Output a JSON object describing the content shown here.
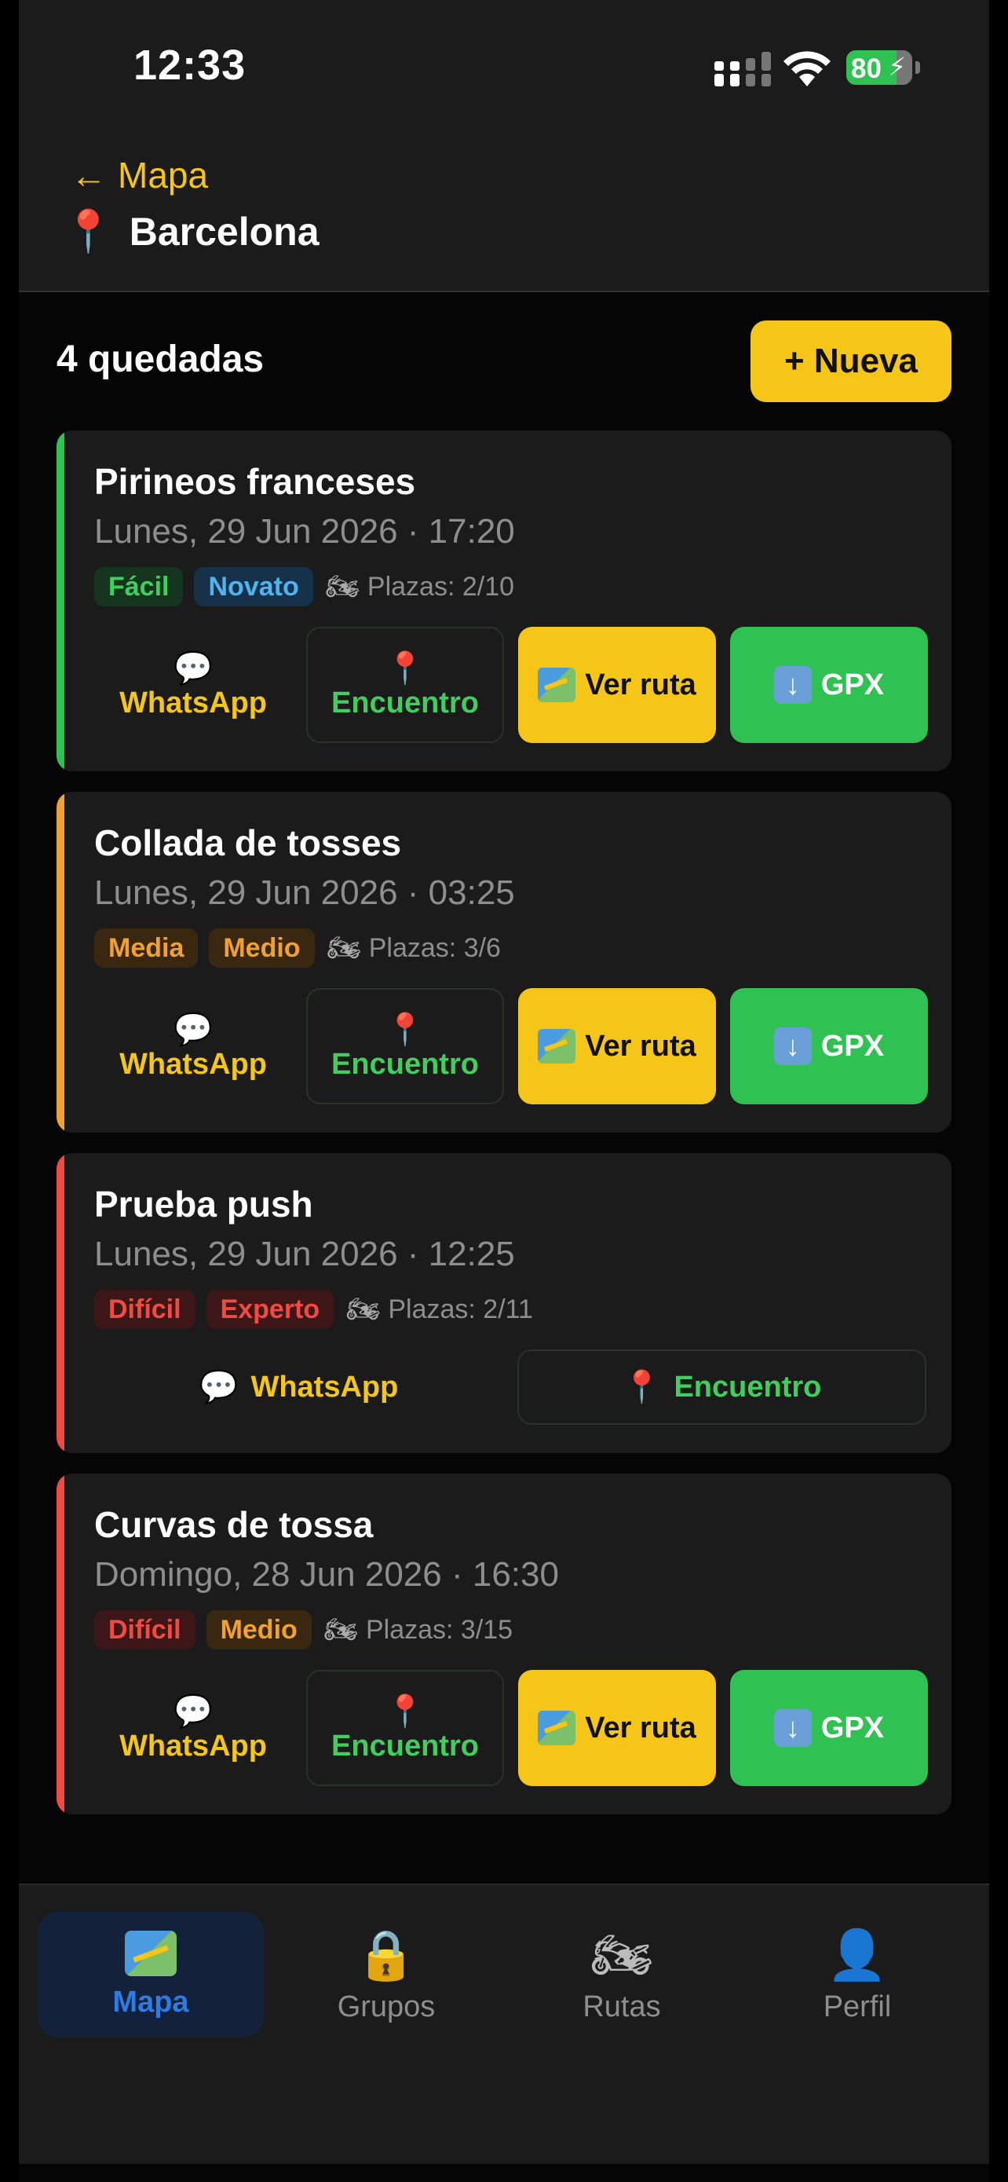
{
  "status_bar": {
    "time": "12:33",
    "battery": "80"
  },
  "header": {
    "back_label": "Mapa",
    "city": "Barcelona"
  },
  "list": {
    "count_label": "4 quedadas",
    "new_button": "+ Nueva"
  },
  "colors": {
    "accent_yellow": "#f5c518",
    "green": "#2fc253",
    "orange": "#f0a132",
    "red": "#ef4b43",
    "blue_active": "#2d7be5"
  },
  "rides": [
    {
      "title": "Pirineos franceses",
      "date": "Lunes, 29 Jun 2026 · 17:20",
      "difficulty": "Fácil",
      "level": "Novato",
      "slots": "Plazas: 2/10",
      "stripe_color": "#2fc253"
    },
    {
      "title": "Collada de tosses",
      "date": "Lunes, 29 Jun 2026 · 03:25",
      "difficulty": "Media",
      "level": "Medio",
      "slots": "Plazas: 3/6",
      "stripe_color": "#f0a132"
    },
    {
      "title": "Prueba push",
      "date": "Lunes, 29 Jun 2026 · 12:25",
      "difficulty": "Difícil",
      "level": "Experto",
      "slots": "Plazas: 2/11",
      "stripe_color": "#ef4b43"
    },
    {
      "title": "Curvas de tossa",
      "date": "Domingo, 28 Jun 2026 · 16:30",
      "difficulty": "Difícil",
      "level": "Medio",
      "slots": "Plazas: 3/15",
      "stripe_color": "#ef4b43"
    }
  ],
  "actions": {
    "whatsapp": "WhatsApp",
    "meeting": "Encuentro",
    "route": "Ver ruta",
    "gpx": "GPX"
  },
  "tabs": [
    {
      "label": "Mapa",
      "icon": "map-icon",
      "active": true
    },
    {
      "label": "Grupos",
      "icon": "lock-icon",
      "active": false
    },
    {
      "label": "Rutas",
      "icon": "motorcycle-icon",
      "active": false
    },
    {
      "label": "Perfil",
      "icon": "person-icon",
      "active": false
    }
  ]
}
